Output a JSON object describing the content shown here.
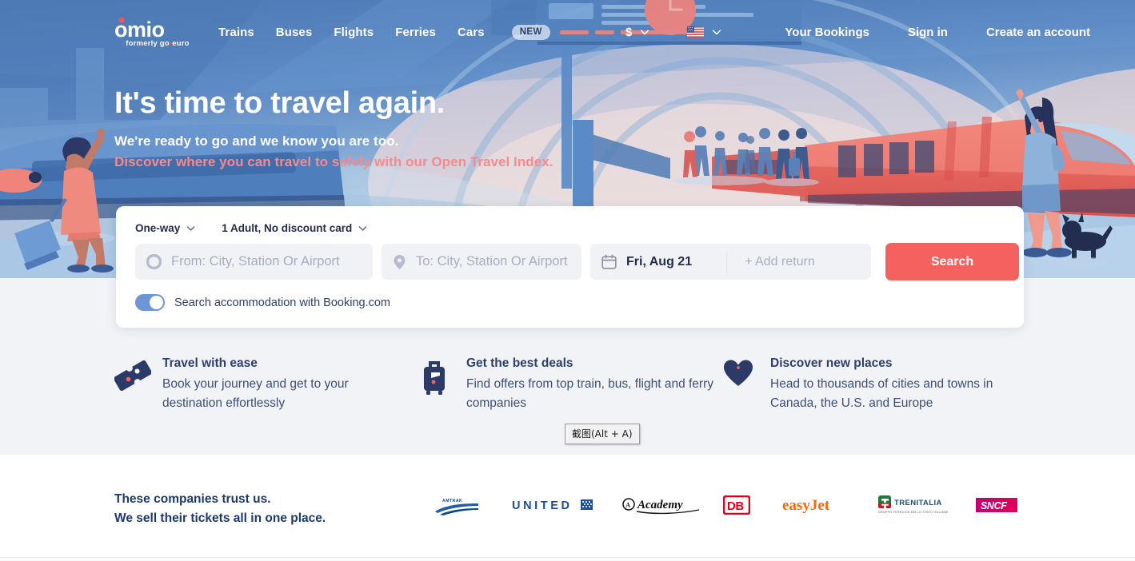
{
  "header": {
    "logo": {
      "name": "omio",
      "tagline_pre": "formerly go",
      "tagline_dot": "•",
      "tagline_post": "euro"
    },
    "nav_items": [
      {
        "label": "Trains",
        "name": "nav-trains"
      },
      {
        "label": "Buses",
        "name": "nav-buses"
      },
      {
        "label": "Flights",
        "name": "nav-flights"
      },
      {
        "label": "Ferries",
        "name": "nav-ferries"
      },
      {
        "label": "Cars",
        "name": "nav-cars",
        "badge": "NEW"
      }
    ],
    "currency": "$",
    "language_flag": "us-flag",
    "account_links": [
      {
        "label": "Your Bookings",
        "name": "your-bookings-link"
      },
      {
        "label": "Sign in",
        "name": "sign-in-link"
      },
      {
        "label": "Create an account",
        "name": "create-account-link"
      }
    ]
  },
  "hero": {
    "headline": "It's time to travel again.",
    "subhead": "We're ready to go and we know you are too.",
    "link_text": "Discover where you can travel to safely with our Open Travel Index.",
    "link_color": "#f78a8d"
  },
  "search": {
    "trip_type": "One-way",
    "passengers": "1 Adult, No discount card",
    "from_placeholder": "From: City, Station Or Airport",
    "to_placeholder": "To: City, Station Or Airport",
    "date_value": "Fri, Aug 21",
    "return_placeholder": "+ Add return",
    "search_label": "Search",
    "accommodation_label": "Search accommodation with Booking.com",
    "accommodation_on": true,
    "accent_color": "#f4615f"
  },
  "features": [
    {
      "icon": "ticket-icon",
      "title": "Travel with ease",
      "desc": "Book your journey and get to your destination effortlessly"
    },
    {
      "icon": "suitcase-icon",
      "title": "Get the best deals",
      "desc": "Find offers from top train, bus, flight and ferry companies"
    },
    {
      "icon": "heart-icon",
      "title": "Discover new places",
      "desc": "Head to thousands of cities and towns in Canada, the U.S. and Europe"
    }
  ],
  "tooltip": {
    "text": "截图(Alt + A)"
  },
  "trust": {
    "line1": "These companies trust us.",
    "line2": "We sell their tickets all in one place.",
    "logos": [
      {
        "name": "amtrak-logo",
        "label": "AMTRAK"
      },
      {
        "name": "united-logo",
        "label": "UNITED"
      },
      {
        "name": "academy-logo",
        "label": "Academy"
      },
      {
        "name": "db-logo",
        "label": "DB"
      },
      {
        "name": "easyjet-logo",
        "label": "easyJet"
      },
      {
        "name": "trenitalia-logo",
        "label": "TRENITALIA"
      },
      {
        "name": "sncf-logo",
        "label": "SNCF"
      }
    ]
  }
}
